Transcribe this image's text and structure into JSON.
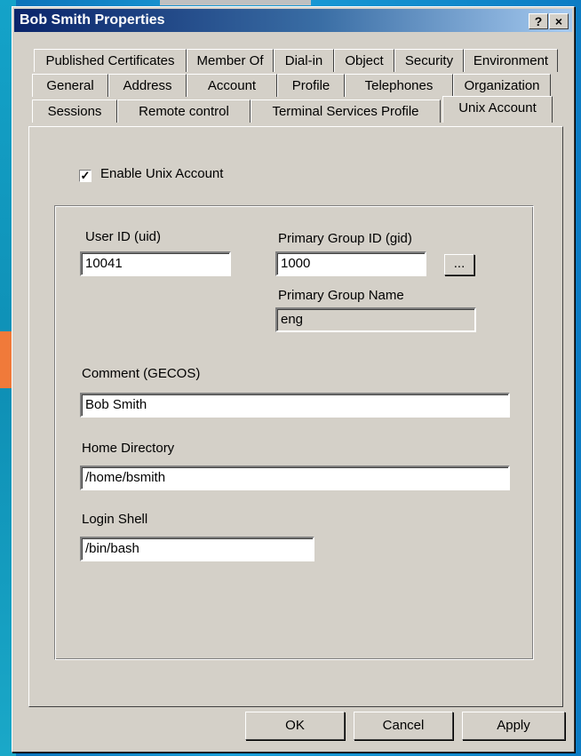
{
  "window": {
    "title": "Bob Smith Properties",
    "help_label": "?",
    "close_label": "×"
  },
  "tabs": {
    "row1": [
      "Published Certificates",
      "Member Of",
      "Dial-in",
      "Object",
      "Security",
      "Environment"
    ],
    "row2": [
      "General",
      "Address",
      "Account",
      "Profile",
      "Telephones",
      "Organization"
    ],
    "row3": [
      "Sessions",
      "Remote control",
      "Terminal Services Profile",
      "Unix Account"
    ]
  },
  "unix": {
    "enable_label": "Enable Unix Account",
    "enable_checked": true,
    "check_glyph": "✓",
    "uid_label": "User ID (uid)",
    "uid_value": "10041",
    "gid_label": "Primary Group ID (gid)",
    "gid_value": "1000",
    "browse_label": "...",
    "group_name_label": "Primary Group Name",
    "group_name_value": "eng",
    "comment_label": "Comment  (GECOS)",
    "comment_value": "Bob Smith",
    "home_label": "Home Directory",
    "home_value": "/home/bsmith",
    "shell_label": "Login Shell",
    "shell_value": "/bin/bash"
  },
  "buttons": {
    "ok": "OK",
    "cancel": "Cancel",
    "apply": "Apply"
  },
  "colors": {
    "accent": "#0a246a",
    "arrow": "#f07a3a",
    "dialog": "#d4d0c8"
  }
}
